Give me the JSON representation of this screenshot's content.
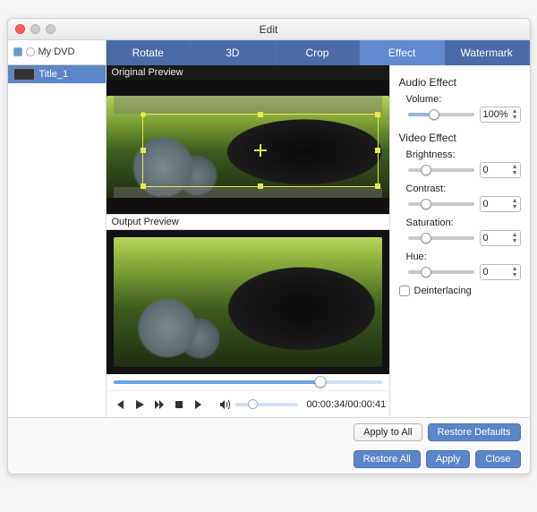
{
  "window": {
    "title": "Edit"
  },
  "sidebar": {
    "disc_label": "My DVD",
    "items": [
      {
        "label": "Title_1"
      }
    ]
  },
  "tabs": {
    "items": [
      "Rotate",
      "3D",
      "Crop",
      "Effect",
      "Watermark"
    ],
    "active": 3
  },
  "preview": {
    "original_label": "Original Preview",
    "output_label": "Output Preview"
  },
  "playback": {
    "time_current": "00:00:34",
    "time_total": "00:00:41",
    "progress_pct": 77,
    "volume_pct": 22
  },
  "effects": {
    "audio_section": "Audio Effect",
    "volume_label": "Volume:",
    "volume_value": "100%",
    "video_section": "Video Effect",
    "brightness_label": "Brightness:",
    "brightness_value": "0",
    "contrast_label": "Contrast:",
    "contrast_value": "0",
    "saturation_label": "Saturation:",
    "saturation_value": "0",
    "hue_label": "Hue:",
    "hue_value": "0",
    "deinterlace_label": "Deinterlacing"
  },
  "buttons": {
    "apply_all": "Apply to All",
    "restore_defaults": "Restore Defaults",
    "restore_all": "Restore All",
    "apply": "Apply",
    "close": "Close"
  }
}
